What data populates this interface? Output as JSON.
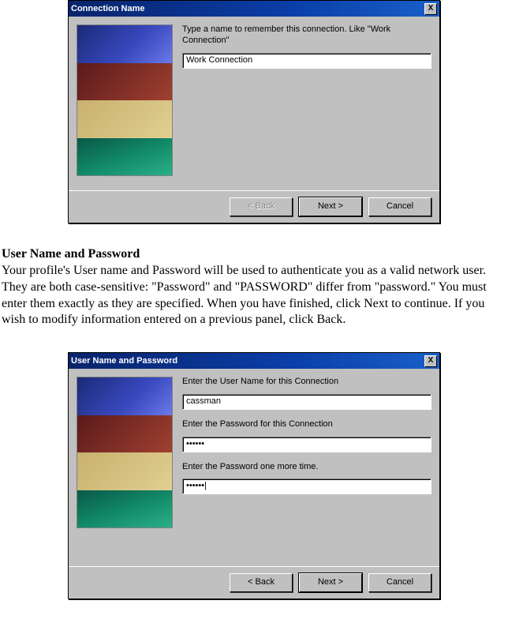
{
  "dialog1": {
    "title": "Connection Name",
    "close": "X",
    "instruction": "Type a name to remember this connection. Like \"Work Connection\"",
    "input_value": "Work Connection",
    "buttons": {
      "back": "< Back",
      "next": "Next >",
      "cancel": "Cancel"
    }
  },
  "doc": {
    "heading": "User Name and Password",
    "paragraph": "Your profile's User name and Password will be used to authenticate you as a valid network user. They are both case-sensitive: \"Password\" and \"PASSWORD\" differ from \"password.\" You must enter them exactly as they are specified. When you have finished, click Next to continue. If you wish to modify information entered on a previous panel, click Back."
  },
  "dialog2": {
    "title": "User Name and Password",
    "close": "X",
    "label_user": "Enter the User Name for this Connection",
    "user_value": "cassman",
    "label_pw": "Enter the Password for this Connection",
    "pw_value": "••••••",
    "label_pw2": "Enter the Password one more time.",
    "pw2_value": "••••••|",
    "buttons": {
      "back": "< Back",
      "next": "Next >",
      "cancel": "Cancel"
    }
  }
}
